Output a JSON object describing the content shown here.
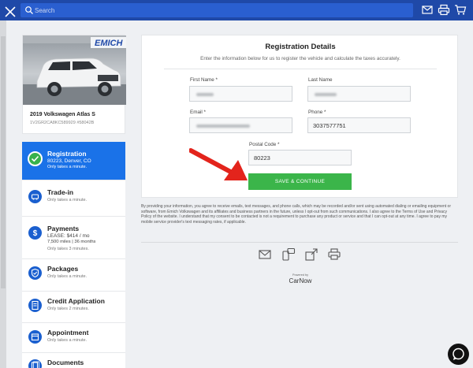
{
  "search": {
    "placeholder": "Search"
  },
  "vehicle": {
    "dealer_logo": "EMICH",
    "name": "2019 Volkswagen Atlas S",
    "vin_stock": "1V2GR2CA8KC589929  #58042B"
  },
  "steps": [
    {
      "title": "Registration",
      "line1": "80223, Denver, CO",
      "line2": "Only takes a minute.",
      "icon": "check-icon"
    },
    {
      "title": "Trade-in",
      "line1": "Only takes a minute.",
      "icon": "trade-in-icon"
    },
    {
      "title": "Payments",
      "line1": "LEASE: $414 / mo",
      "line2": "7,500 miles | 36 months",
      "line3": "Only takes 3 minutes.",
      "icon": "dollar-icon"
    },
    {
      "title": "Packages",
      "line1": "Only takes a minute.",
      "icon": "shield-icon"
    },
    {
      "title": "Credit Application",
      "line1": "Only takes 2 minutes.",
      "icon": "document-icon"
    },
    {
      "title": "Appointment",
      "line1": "Only takes a minute.",
      "icon": "calendar-icon"
    },
    {
      "title": "Documents",
      "line1": "",
      "icon": "documents-icon"
    }
  ],
  "form": {
    "title": "Registration Details",
    "intro": "Enter the information below for us to register the vehicle and calculate the taxes accurately.",
    "first_name_label": "First Name *",
    "last_name_label": "Last Name",
    "email_label": "Email *",
    "phone_label": "Phone *",
    "phone_value": "3037577751",
    "postal_label": "Postal Code *",
    "postal_value": "80223",
    "save_label": "SAVE & CONTINUE"
  },
  "disclaimer": "By providing your information, you agree to receive emails, text messages, and phone calls, which may be recorded and/or sent using automated dialing or emailing equipment or software, from Emich Volkswagen and its affiliates and business partners in the future, unless I opt-out from such communications. I also agree to the Terms of Use and Privacy Policy of the website. I understand that my consent to be contacted is not a requirement to purchase any product or service and that I can opt-out at any time. I agree to pay my mobile service provider's text messaging rates, if applicable.",
  "footer": {
    "powered_by": "Powered by",
    "brand": "CarNow"
  },
  "colors": {
    "topbar": "#1f49a8",
    "active_step": "#1a72e8",
    "save_button": "#3bb54a",
    "arrow": "#e3241c"
  }
}
